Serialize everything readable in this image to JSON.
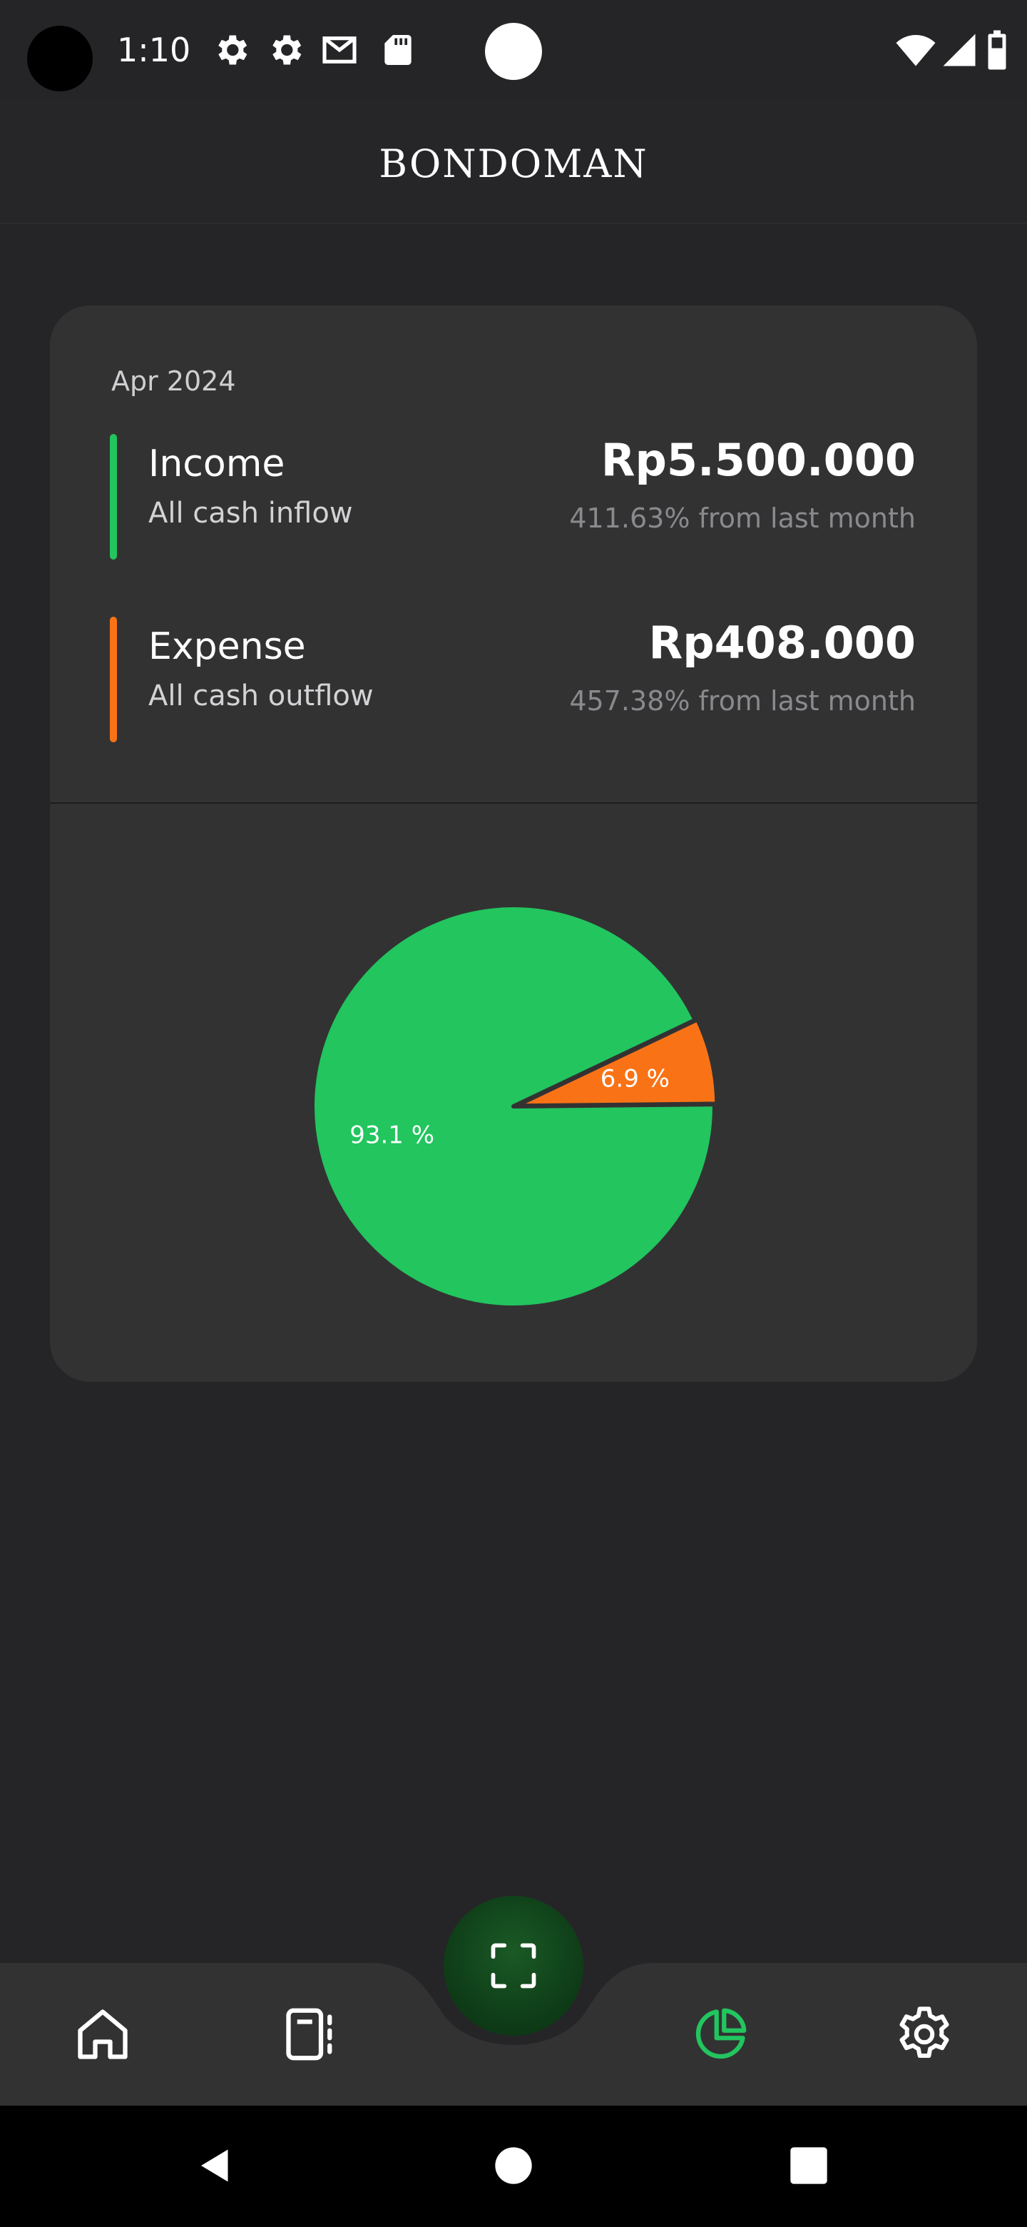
{
  "status_bar": {
    "time": "1:10",
    "left_icons": [
      "settings-icon",
      "settings-icon",
      "gmail-icon",
      "sd-card-icon"
    ],
    "right_icons": [
      "wifi-icon",
      "signal-icon",
      "battery-icon"
    ]
  },
  "header": {
    "title": "BONDOMAN"
  },
  "summary": {
    "month": "Apr 2024",
    "income": {
      "title": "Income",
      "subtitle": "All cash inflow",
      "amount": "Rp5.500.000",
      "change": "411.63% from last month",
      "color": "#22c55e"
    },
    "expense": {
      "title": "Expense",
      "subtitle": "All cash outflow",
      "amount": "Rp408.000",
      "change": "457.38% from last month",
      "color": "#f97316"
    }
  },
  "chart_data": {
    "type": "pie",
    "slices": [
      {
        "label": "Income",
        "value": 93.1,
        "display": "93.1 %",
        "color": "#22c55e"
      },
      {
        "label": "Expense",
        "value": 6.9,
        "display": "6.9 %",
        "color": "#f97316"
      }
    ]
  },
  "bottom_nav": {
    "items": [
      "home-icon",
      "transactions-icon",
      "graph-icon",
      "settings-icon"
    ],
    "active": "graph-icon",
    "fab_icon": "scan-icon",
    "active_color": "#22c55e"
  },
  "system_nav": [
    "back-icon",
    "home-circle-icon",
    "recents-icon"
  ]
}
